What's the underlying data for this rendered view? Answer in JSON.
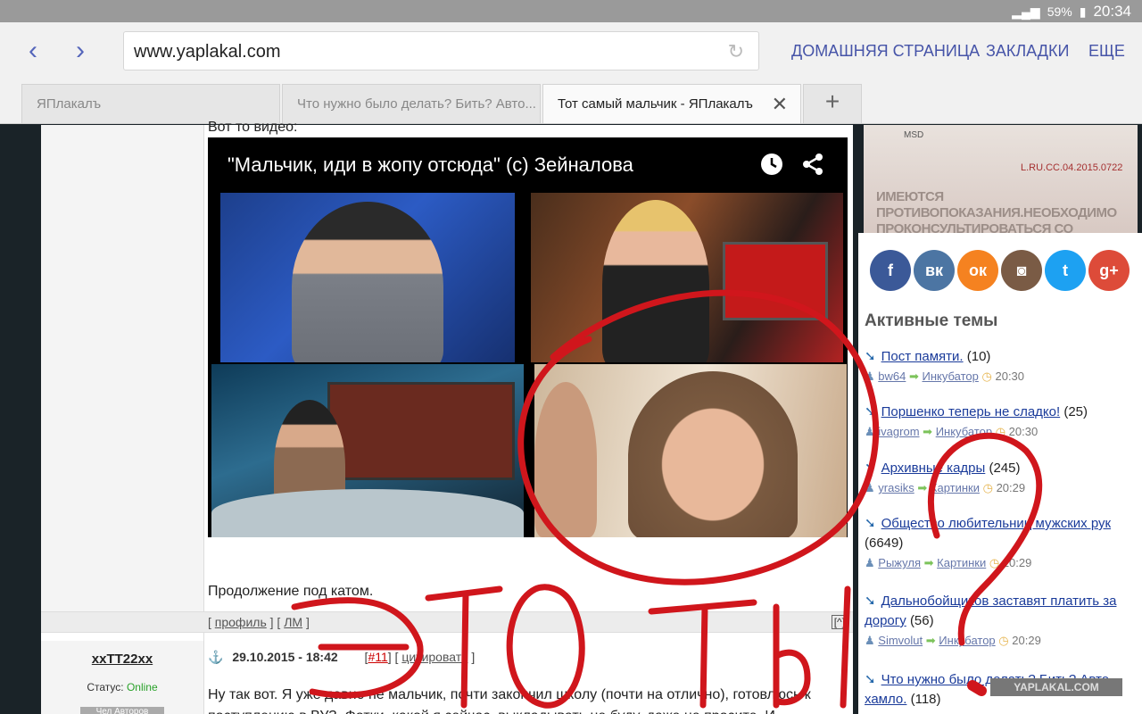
{
  "status_bar": {
    "battery": "59%",
    "time": "20:34"
  },
  "browser": {
    "url": "www.yaplakal.com",
    "nav_links": [
      "ДОМАШНЯЯ СТРАНИЦА",
      "ЗАКЛАДКИ",
      "ЕЩЕ"
    ],
    "tabs": [
      {
        "title": "ЯПлакалъ"
      },
      {
        "title": "Что нужно было делать? Бить? Авто..."
      },
      {
        "title": "Тот самый мальчик - ЯПлакалъ"
      }
    ],
    "new_tab_label": "+"
  },
  "post": {
    "partial_top_text": "Вот то видео:",
    "video_title": "\"Мальчик, иди в жопу отсюда\" (с) Зейналова",
    "continue_text": "Продолжение под катом.",
    "footer_links": [
      "профиль",
      "ЛМ"
    ],
    "up_button": "[^]"
  },
  "comment": {
    "username": "xxTT22xx",
    "status_label": "Статус:",
    "status_value": "Online",
    "badge": "Чел Авторов",
    "date": "29.10.2015 - 18:42",
    "number": "#11",
    "quote_link": "цитировать",
    "text": "Ну так вот. Я уже давно не мальчик, почти закончил школу (почти на отлично), готовлюсь к поступлению в ВУЗ. Фотки, какой я сейчас, выкладывать не буду, даже не просите. И"
  },
  "ad": {
    "logo": "MSD",
    "code": "L.RU.CC.04.2015.0722",
    "warning": "ИМЕЮТСЯ ПРОТИВОПОКАЗАНИЯ.НЕОБХОДИМО ПРОКОНСУЛЬТИРОВАТЬСЯ СО СПЕЦИАЛИСТОМ"
  },
  "social": [
    {
      "name": "facebook",
      "glyph": "f",
      "color": "#3b5998"
    },
    {
      "name": "vkontakte",
      "glyph": "вк",
      "color": "#4c75a3"
    },
    {
      "name": "odnoklassniki",
      "glyph": "ок",
      "color": "#f58220"
    },
    {
      "name": "instagram",
      "glyph": "◙",
      "color": "#7a5b45"
    },
    {
      "name": "twitter",
      "glyph": "t",
      "color": "#1da1f2"
    },
    {
      "name": "googleplus",
      "glyph": "g+",
      "color": "#dd4b39"
    }
  ],
  "sidebar": {
    "title": "Активные темы",
    "topics": [
      {
        "title": "Пост памяти.",
        "count": "(10)",
        "user": "bw64",
        "section": "Инкубатор",
        "time": "20:30"
      },
      {
        "title": "Поршенко теперь не сладко!",
        "count": "(25)",
        "user": "ivagrom",
        "section": "Инкубатор",
        "time": "20:30"
      },
      {
        "title": "Архивные кадры",
        "count": "(245)",
        "user": "yrasiks",
        "section": "Картинки",
        "time": "20:29"
      },
      {
        "title": "Общество любительниц мужских рук",
        "count": "(6649)",
        "user": "Рыжуля",
        "section": "Картинки",
        "time": "20:29"
      },
      {
        "title": "Дальнобойщиков заставят платить за дорогу",
        "count": "(56)",
        "user": "Simvolut",
        "section": "Инкубатор",
        "time": "20:29"
      },
      {
        "title": "Что нужно было делать? Бить? Авто хамло.",
        "count": "(118)",
        "user": "",
        "section": "",
        "time": ""
      }
    ]
  },
  "overlay": {
    "handwriting": "ЭТО ТЫ ?",
    "color": "#d0161c"
  },
  "watermark": "YAPLAKAL.COM"
}
